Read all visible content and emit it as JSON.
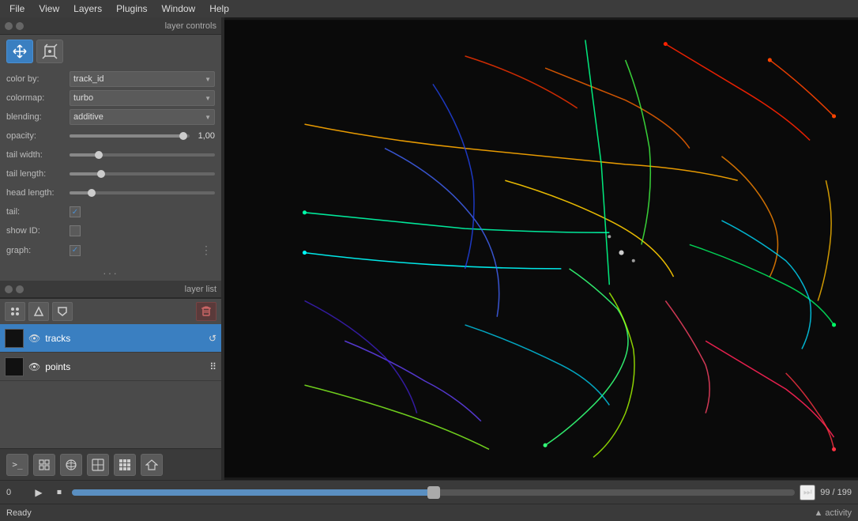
{
  "menubar": {
    "items": [
      "File",
      "View",
      "Layers",
      "Plugins",
      "Window",
      "Help"
    ]
  },
  "left_panel": {
    "layer_controls_title": "layer controls",
    "tools": [
      {
        "name": "move-tool",
        "icon": "⊕",
        "active": true
      },
      {
        "name": "transform-tool",
        "icon": "✦",
        "active": false
      }
    ],
    "controls": [
      {
        "label": "color by:",
        "type": "dropdown",
        "value": "track_id"
      },
      {
        "label": "colormap:",
        "type": "dropdown",
        "value": "turbo"
      },
      {
        "label": "blending:",
        "type": "dropdown",
        "value": "additive"
      },
      {
        "label": "opacity:",
        "type": "slider",
        "value": "1,00",
        "fill_pct": 95
      },
      {
        "label": "tail width:",
        "type": "slider",
        "value": "",
        "fill_pct": 20
      },
      {
        "label": "tail length:",
        "type": "slider",
        "value": "",
        "fill_pct": 22
      },
      {
        "label": "head length:",
        "type": "slider",
        "value": "",
        "fill_pct": 15
      },
      {
        "label": "tail:",
        "type": "checkbox",
        "checked": true
      },
      {
        "label": "show ID:",
        "type": "checkbox",
        "checked": false
      },
      {
        "label": "graph:",
        "type": "checkbox",
        "checked": true
      }
    ],
    "layer_list_title": "layer list",
    "layers": [
      {
        "name": "tracks",
        "visible": true,
        "active": true,
        "icon": "↺"
      },
      {
        "name": "points",
        "visible": true,
        "active": false,
        "icon": "⠿"
      }
    ]
  },
  "bottom_toolbar": {
    "buttons": [
      {
        "name": "console-btn",
        "icon": ">_"
      },
      {
        "name": "grid-btn",
        "icon": "⊞"
      },
      {
        "name": "3d-btn",
        "icon": "◎"
      },
      {
        "name": "split-btn",
        "icon": "⊡"
      },
      {
        "name": "dots-btn",
        "icon": "⠿"
      },
      {
        "name": "home-btn",
        "icon": "⌂"
      }
    ]
  },
  "playback": {
    "start_frame": "0",
    "current_frame": "99",
    "end_frame": "199",
    "progress_pct": 50
  },
  "status": {
    "text": "Ready",
    "activity_label": "▲ activity"
  }
}
